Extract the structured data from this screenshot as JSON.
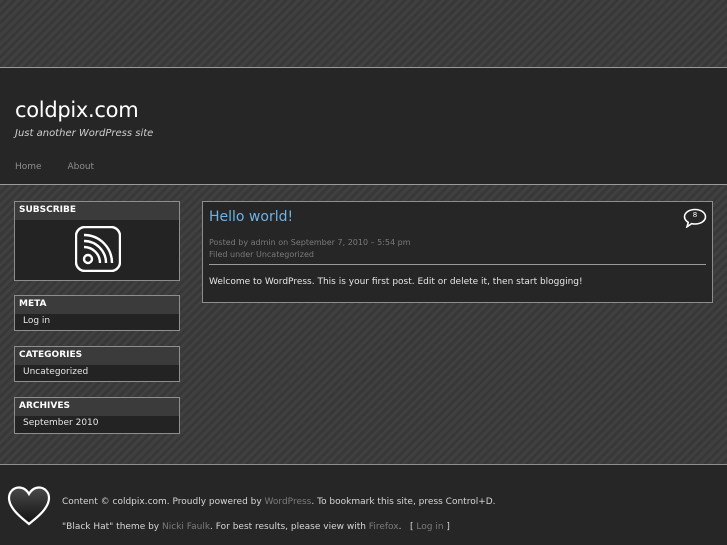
{
  "site": {
    "title": "coldpix.com",
    "description": "Just another WordPress site"
  },
  "nav": {
    "items": [
      "Home",
      "About"
    ]
  },
  "sidebar": {
    "subscribe": {
      "title": "SUBSCRIBE",
      "icon": "rss-icon"
    },
    "meta": {
      "title": "META",
      "items": [
        "Log in"
      ]
    },
    "categories": {
      "title": "CATEGORIES",
      "items": [
        "Uncategorized"
      ]
    },
    "archives": {
      "title": "ARCHIVES",
      "items": [
        "September 2010"
      ]
    }
  },
  "post": {
    "title": "Hello world!",
    "comment_count": "8",
    "meta_posted": "Posted by admin on September 7, 2010 – 5:54 pm",
    "meta_filed": "Filed under Uncategorized",
    "body": "Welcome to WordPress. This is your first post. Edit or delete it, then start blogging!"
  },
  "footer": {
    "line1_prefix": "Content © coldpix.com. Proudly powered by ",
    "line1_link": "WordPress",
    "line1_suffix": ". To bookmark this site, press Control+D.",
    "line2_prefix": "\"Black Hat\" theme by ",
    "line2_link_author": "Nicki Faulk",
    "line2_mid": ". For best results, please view with ",
    "line2_link_browser": "Firefox",
    "line2_after": ".   [ ",
    "line2_login": "Log in",
    "line2_end": " ]",
    "icon": "heart-icon"
  },
  "colors": {
    "accent_link": "#6fb2e4",
    "header_bg": "#262626",
    "widget_title_bg": "#3b3b3b"
  }
}
